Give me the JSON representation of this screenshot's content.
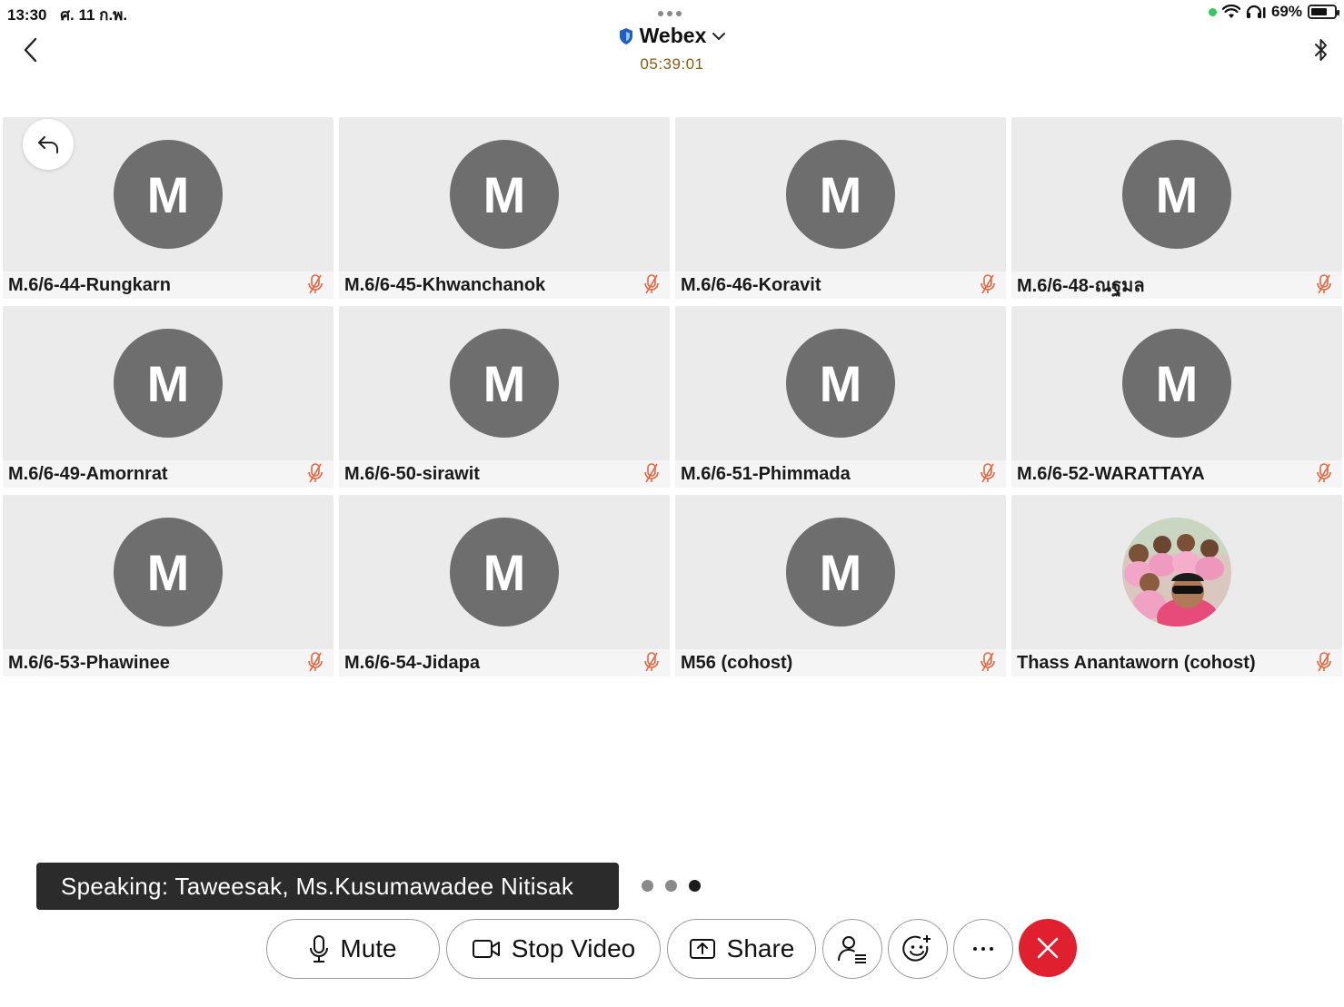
{
  "status_bar": {
    "time": "13:30",
    "date": "ศ. 11 ก.พ.",
    "battery": "69%",
    "battery_level": 0.69
  },
  "header": {
    "title": "Webex",
    "timer": "05:39:01"
  },
  "participants": [
    {
      "initial": "M",
      "name": "M.6/6-44-Rungkarn",
      "muted": true
    },
    {
      "initial": "M",
      "name": "M.6/6-45-Khwanchanok",
      "muted": true
    },
    {
      "initial": "M",
      "name": "M.6/6-46-Koravit",
      "muted": true
    },
    {
      "initial": "M",
      "name": "M.6/6-48-ณฐมล",
      "muted": true
    },
    {
      "initial": "M",
      "name": "M.6/6-49-Amornrat",
      "muted": true
    },
    {
      "initial": "M",
      "name": "M.6/6-50-sirawit",
      "muted": true
    },
    {
      "initial": "M",
      "name": "M.6/6-51-Phimmada",
      "muted": true
    },
    {
      "initial": "M",
      "name": "M.6/6-52-WARATTAYA",
      "muted": true
    },
    {
      "initial": "M",
      "name": "M.6/6-53-Phawinee",
      "muted": true
    },
    {
      "initial": "M",
      "name": "M.6/6-54-Jidapa",
      "muted": true
    },
    {
      "initial": "M",
      "name": "M56 (cohost)",
      "muted": true
    },
    {
      "initial": "",
      "name": "Thass Anantaworn (cohost)",
      "muted": true,
      "photo": true
    }
  ],
  "speaking": "Speaking: Taweesak, Ms.Kusumawadee Nitisak",
  "pager": {
    "pages": 3,
    "active": 3
  },
  "controls": {
    "mute_label": "Mute",
    "stop_video_label": "Stop Video",
    "share_label": "Share"
  },
  "colors": {
    "end_call": "#e0202f",
    "muted_icon": "#e8643c",
    "avatar": "#6e6e6e",
    "timer": "#8a5a14"
  }
}
